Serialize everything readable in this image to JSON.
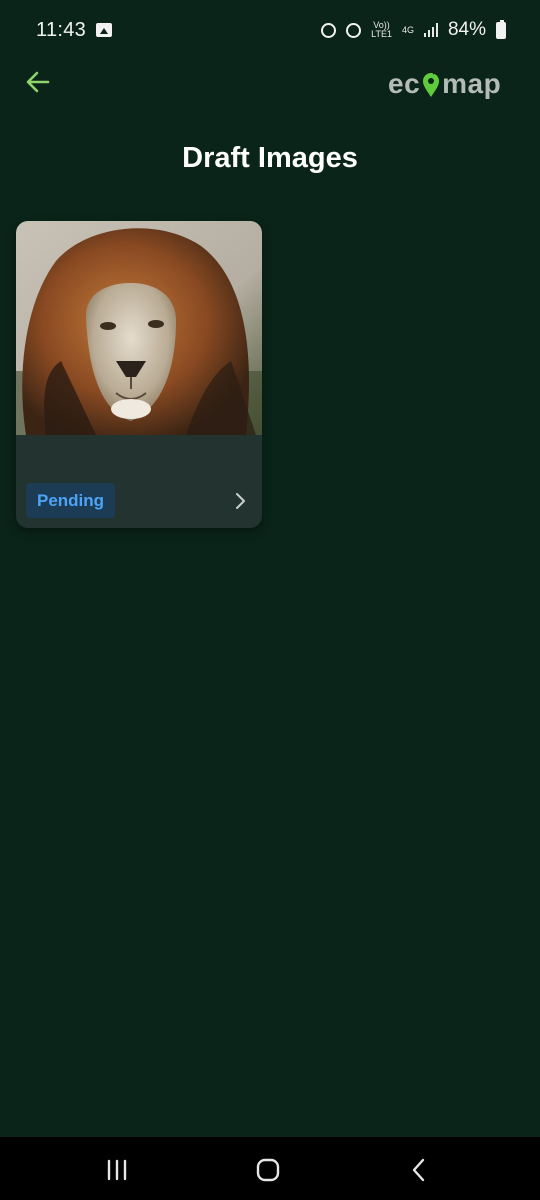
{
  "status_bar": {
    "time": "11:43",
    "volte_top": "Vo))",
    "volte_bottom": "LTE1",
    "network": "4G",
    "battery": "84%"
  },
  "header": {
    "logo_left": "ec",
    "logo_right": "map",
    "back_icon": "arrow-left-icon",
    "accent_color": "#8fd46a"
  },
  "page": {
    "title": "Draft Images"
  },
  "drafts": [
    {
      "image": "lion-photo",
      "status": "Pending",
      "status_color": "#4da3f5"
    }
  ],
  "nav": {
    "recents_icon": "recents-icon",
    "home_icon": "home-icon",
    "back_icon": "back-icon"
  }
}
